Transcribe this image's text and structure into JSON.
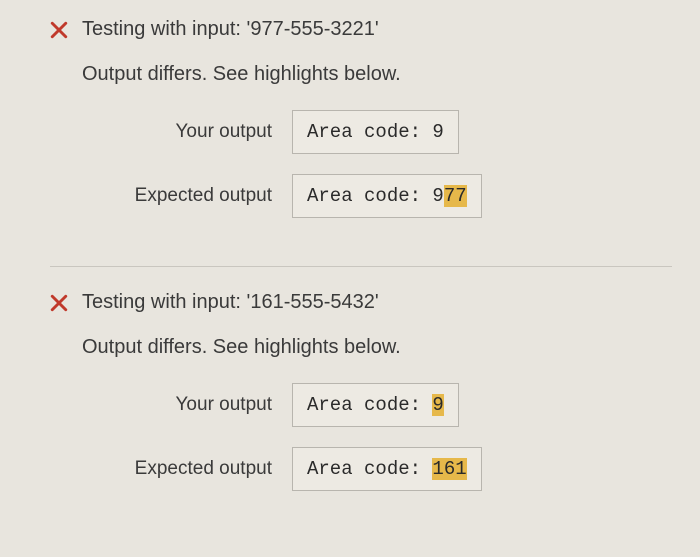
{
  "tests": [
    {
      "header": "Testing with input: '977-555-3221'",
      "subtext": "Output differs. See highlights below.",
      "your_label": "Your output",
      "expected_label": "Expected output",
      "your_prefix": "Area code: 9",
      "your_hl": "",
      "expected_prefix": "Area code: 9",
      "expected_hl": "77"
    },
    {
      "header": "Testing with input: '161-555-5432'",
      "subtext": "Output differs. See highlights below.",
      "your_label": "Your output",
      "expected_label": "Expected output",
      "your_prefix": "Area code: ",
      "your_hl": "9",
      "expected_prefix": "Area code: ",
      "expected_hl": "161"
    }
  ]
}
